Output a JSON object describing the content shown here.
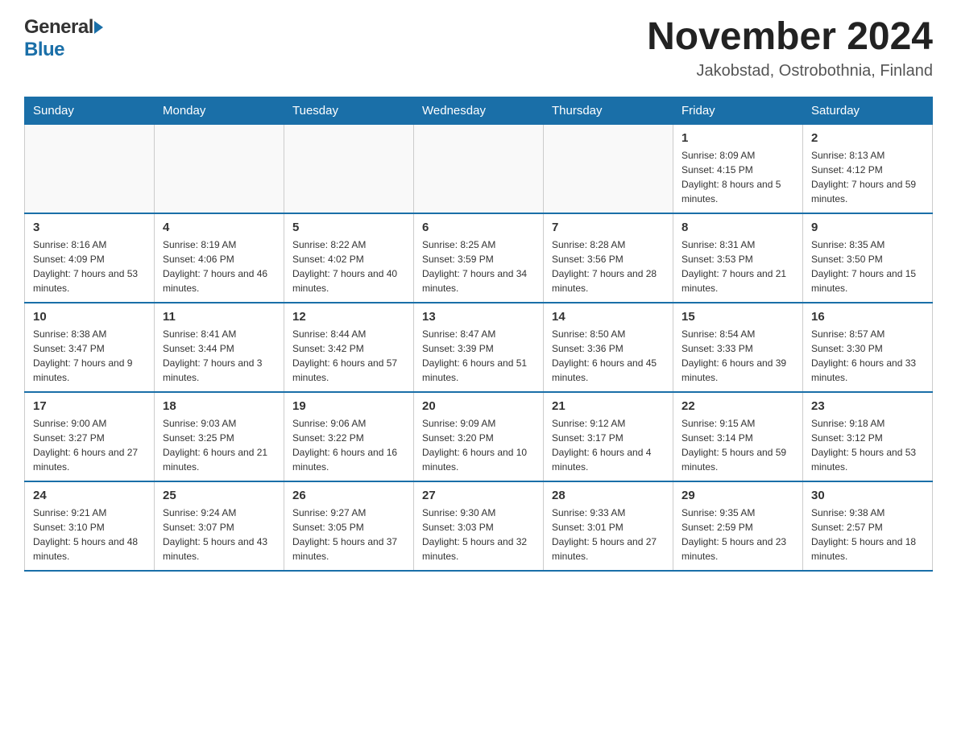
{
  "header": {
    "logo_general": "General",
    "logo_blue": "Blue",
    "month_title": "November 2024",
    "location": "Jakobstad, Ostrobothnia, Finland"
  },
  "weekdays": [
    "Sunday",
    "Monday",
    "Tuesday",
    "Wednesday",
    "Thursday",
    "Friday",
    "Saturday"
  ],
  "weeks": [
    [
      {
        "day": "",
        "sunrise": "",
        "sunset": "",
        "daylight": ""
      },
      {
        "day": "",
        "sunrise": "",
        "sunset": "",
        "daylight": ""
      },
      {
        "day": "",
        "sunrise": "",
        "sunset": "",
        "daylight": ""
      },
      {
        "day": "",
        "sunrise": "",
        "sunset": "",
        "daylight": ""
      },
      {
        "day": "",
        "sunrise": "",
        "sunset": "",
        "daylight": ""
      },
      {
        "day": "1",
        "sunrise": "Sunrise: 8:09 AM",
        "sunset": "Sunset: 4:15 PM",
        "daylight": "Daylight: 8 hours and 5 minutes."
      },
      {
        "day": "2",
        "sunrise": "Sunrise: 8:13 AM",
        "sunset": "Sunset: 4:12 PM",
        "daylight": "Daylight: 7 hours and 59 minutes."
      }
    ],
    [
      {
        "day": "3",
        "sunrise": "Sunrise: 8:16 AM",
        "sunset": "Sunset: 4:09 PM",
        "daylight": "Daylight: 7 hours and 53 minutes."
      },
      {
        "day": "4",
        "sunrise": "Sunrise: 8:19 AM",
        "sunset": "Sunset: 4:06 PM",
        "daylight": "Daylight: 7 hours and 46 minutes."
      },
      {
        "day": "5",
        "sunrise": "Sunrise: 8:22 AM",
        "sunset": "Sunset: 4:02 PM",
        "daylight": "Daylight: 7 hours and 40 minutes."
      },
      {
        "day": "6",
        "sunrise": "Sunrise: 8:25 AM",
        "sunset": "Sunset: 3:59 PM",
        "daylight": "Daylight: 7 hours and 34 minutes."
      },
      {
        "day": "7",
        "sunrise": "Sunrise: 8:28 AM",
        "sunset": "Sunset: 3:56 PM",
        "daylight": "Daylight: 7 hours and 28 minutes."
      },
      {
        "day": "8",
        "sunrise": "Sunrise: 8:31 AM",
        "sunset": "Sunset: 3:53 PM",
        "daylight": "Daylight: 7 hours and 21 minutes."
      },
      {
        "day": "9",
        "sunrise": "Sunrise: 8:35 AM",
        "sunset": "Sunset: 3:50 PM",
        "daylight": "Daylight: 7 hours and 15 minutes."
      }
    ],
    [
      {
        "day": "10",
        "sunrise": "Sunrise: 8:38 AM",
        "sunset": "Sunset: 3:47 PM",
        "daylight": "Daylight: 7 hours and 9 minutes."
      },
      {
        "day": "11",
        "sunrise": "Sunrise: 8:41 AM",
        "sunset": "Sunset: 3:44 PM",
        "daylight": "Daylight: 7 hours and 3 minutes."
      },
      {
        "day": "12",
        "sunrise": "Sunrise: 8:44 AM",
        "sunset": "Sunset: 3:42 PM",
        "daylight": "Daylight: 6 hours and 57 minutes."
      },
      {
        "day": "13",
        "sunrise": "Sunrise: 8:47 AM",
        "sunset": "Sunset: 3:39 PM",
        "daylight": "Daylight: 6 hours and 51 minutes."
      },
      {
        "day": "14",
        "sunrise": "Sunrise: 8:50 AM",
        "sunset": "Sunset: 3:36 PM",
        "daylight": "Daylight: 6 hours and 45 minutes."
      },
      {
        "day": "15",
        "sunrise": "Sunrise: 8:54 AM",
        "sunset": "Sunset: 3:33 PM",
        "daylight": "Daylight: 6 hours and 39 minutes."
      },
      {
        "day": "16",
        "sunrise": "Sunrise: 8:57 AM",
        "sunset": "Sunset: 3:30 PM",
        "daylight": "Daylight: 6 hours and 33 minutes."
      }
    ],
    [
      {
        "day": "17",
        "sunrise": "Sunrise: 9:00 AM",
        "sunset": "Sunset: 3:27 PM",
        "daylight": "Daylight: 6 hours and 27 minutes."
      },
      {
        "day": "18",
        "sunrise": "Sunrise: 9:03 AM",
        "sunset": "Sunset: 3:25 PM",
        "daylight": "Daylight: 6 hours and 21 minutes."
      },
      {
        "day": "19",
        "sunrise": "Sunrise: 9:06 AM",
        "sunset": "Sunset: 3:22 PM",
        "daylight": "Daylight: 6 hours and 16 minutes."
      },
      {
        "day": "20",
        "sunrise": "Sunrise: 9:09 AM",
        "sunset": "Sunset: 3:20 PM",
        "daylight": "Daylight: 6 hours and 10 minutes."
      },
      {
        "day": "21",
        "sunrise": "Sunrise: 9:12 AM",
        "sunset": "Sunset: 3:17 PM",
        "daylight": "Daylight: 6 hours and 4 minutes."
      },
      {
        "day": "22",
        "sunrise": "Sunrise: 9:15 AM",
        "sunset": "Sunset: 3:14 PM",
        "daylight": "Daylight: 5 hours and 59 minutes."
      },
      {
        "day": "23",
        "sunrise": "Sunrise: 9:18 AM",
        "sunset": "Sunset: 3:12 PM",
        "daylight": "Daylight: 5 hours and 53 minutes."
      }
    ],
    [
      {
        "day": "24",
        "sunrise": "Sunrise: 9:21 AM",
        "sunset": "Sunset: 3:10 PM",
        "daylight": "Daylight: 5 hours and 48 minutes."
      },
      {
        "day": "25",
        "sunrise": "Sunrise: 9:24 AM",
        "sunset": "Sunset: 3:07 PM",
        "daylight": "Daylight: 5 hours and 43 minutes."
      },
      {
        "day": "26",
        "sunrise": "Sunrise: 9:27 AM",
        "sunset": "Sunset: 3:05 PM",
        "daylight": "Daylight: 5 hours and 37 minutes."
      },
      {
        "day": "27",
        "sunrise": "Sunrise: 9:30 AM",
        "sunset": "Sunset: 3:03 PM",
        "daylight": "Daylight: 5 hours and 32 minutes."
      },
      {
        "day": "28",
        "sunrise": "Sunrise: 9:33 AM",
        "sunset": "Sunset: 3:01 PM",
        "daylight": "Daylight: 5 hours and 27 minutes."
      },
      {
        "day": "29",
        "sunrise": "Sunrise: 9:35 AM",
        "sunset": "Sunset: 2:59 PM",
        "daylight": "Daylight: 5 hours and 23 minutes."
      },
      {
        "day": "30",
        "sunrise": "Sunrise: 9:38 AM",
        "sunset": "Sunset: 2:57 PM",
        "daylight": "Daylight: 5 hours and 18 minutes."
      }
    ]
  ]
}
